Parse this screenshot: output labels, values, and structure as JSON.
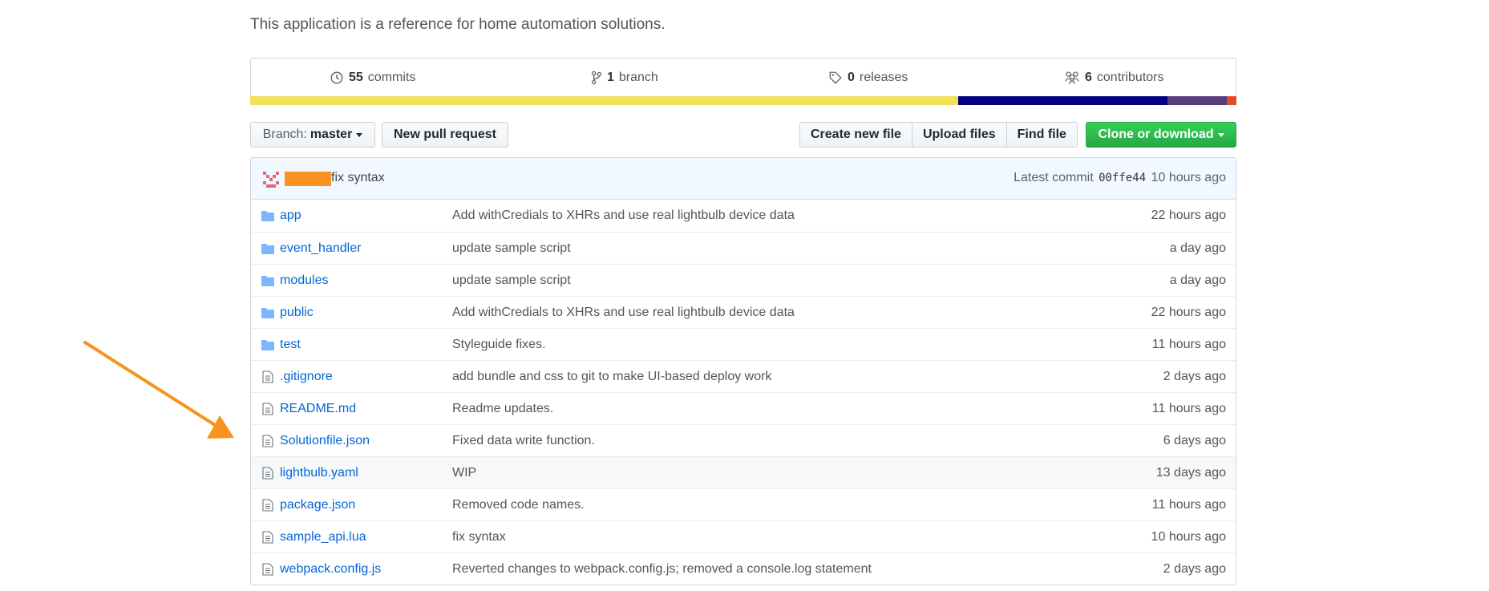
{
  "repo": {
    "description": "This application is a reference for home automation solutions."
  },
  "stats": {
    "commits": {
      "count": "55",
      "label": "commits",
      "icon": "history-icon"
    },
    "branches": {
      "count": "1",
      "label": "branch",
      "icon": "git-branch-icon"
    },
    "releases": {
      "count": "0",
      "label": "releases",
      "icon": "tag-icon"
    },
    "contributors": {
      "count": "6",
      "label": "contributors",
      "icon": "organization-icon"
    }
  },
  "language_bar": [
    {
      "color": "#f1e05a",
      "share": 0.718
    },
    {
      "color": "#000080",
      "share": 0.212
    },
    {
      "color": "#563d7c",
      "share": 0.06
    },
    {
      "color": "#e34c26",
      "share": 0.01
    }
  ],
  "toolbar": {
    "branch_prefix": "Branch:",
    "branch_name": "master",
    "new_pull_request": "New pull request",
    "create_new_file": "Create new file",
    "upload_files": "Upload files",
    "find_file": "Find file",
    "clone_or_download": "Clone or download"
  },
  "latest_commit": {
    "message": "fix syntax",
    "prefix": "Latest commit",
    "sha": "00ffe44",
    "age": "10 hours ago"
  },
  "files": [
    {
      "type": "dir",
      "name": "app",
      "message": "Add withCredials to XHRs and use real lightbulb device data",
      "age": "22 hours ago"
    },
    {
      "type": "dir",
      "name": "event_handler",
      "message": "update sample script",
      "age": "a day ago"
    },
    {
      "type": "dir",
      "name": "modules",
      "message": "update sample script",
      "age": "a day ago"
    },
    {
      "type": "dir",
      "name": "public",
      "message": "Add withCredials to XHRs and use real lightbulb device data",
      "age": "22 hours ago"
    },
    {
      "type": "dir",
      "name": "test",
      "message": "Styleguide fixes.",
      "age": "11 hours ago"
    },
    {
      "type": "file",
      "name": ".gitignore",
      "message": "add bundle and css to git to make UI-based deploy work",
      "age": "2 days ago"
    },
    {
      "type": "file",
      "name": "README.md",
      "message": "Readme updates.",
      "age": "11 hours ago"
    },
    {
      "type": "file",
      "name": "Solutionfile.json",
      "message": "Fixed data write function.",
      "age": "6 days ago"
    },
    {
      "type": "file",
      "name": "lightbulb.yaml",
      "message": "WIP",
      "age": "13 days ago"
    },
    {
      "type": "file",
      "name": "package.json",
      "message": "Removed code names.",
      "age": "11 hours ago"
    },
    {
      "type": "file",
      "name": "sample_api.lua",
      "message": "fix syntax",
      "age": "10 hours ago"
    },
    {
      "type": "file",
      "name": "webpack.config.js",
      "message": "Reverted changes to webpack.config.js; removed a console.log statement",
      "age": "2 days ago"
    }
  ],
  "highlighted_row": "lightbulb.yaml",
  "annotation": {
    "icon": "orange-arrow-icon",
    "color": "#f7931e",
    "points_to": "Solutionfile.json"
  }
}
